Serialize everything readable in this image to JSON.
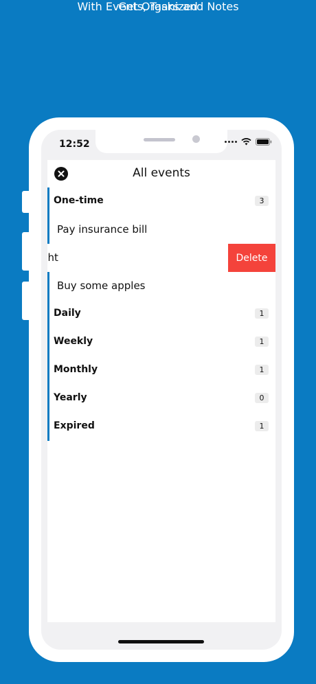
{
  "promo": {
    "title": "Get Organized",
    "subtitle": "With Events, Tasks and Notes"
  },
  "status_bar": {
    "time": "12:52"
  },
  "header": {
    "title": "All events"
  },
  "list": {
    "rows": [
      {
        "type": "category",
        "label": "One-time",
        "count": "3"
      },
      {
        "type": "item",
        "label": "Pay insurance bill"
      },
      {
        "type": "swiped",
        "label": "ght",
        "action": "Delete"
      },
      {
        "type": "item",
        "label": "Buy some apples"
      },
      {
        "type": "category",
        "label": "Daily",
        "count": "1"
      },
      {
        "type": "category",
        "label": "Weekly",
        "count": "1"
      },
      {
        "type": "category",
        "label": "Monthly",
        "count": "1"
      },
      {
        "type": "category",
        "label": "Yearly",
        "count": "0"
      },
      {
        "type": "category",
        "label": "Expired",
        "count": "1"
      }
    ]
  },
  "colors": {
    "accent": "#0a7bc2",
    "delete": "#f4433b"
  }
}
